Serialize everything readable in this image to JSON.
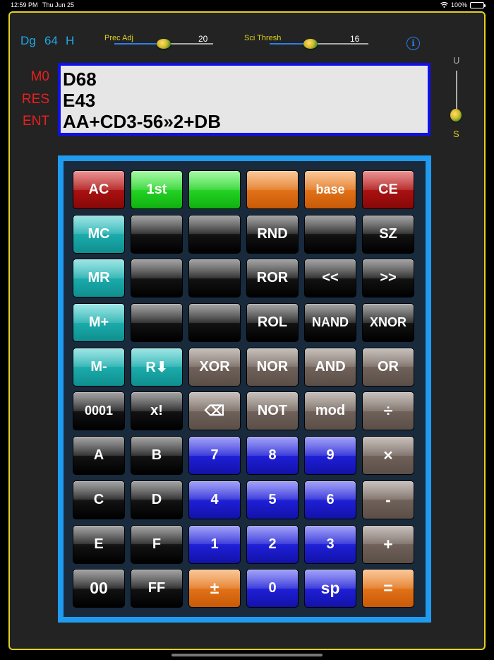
{
  "status_bar": {
    "time": "12:59 PM",
    "date": "Thu Jun 25",
    "battery": "100%"
  },
  "mode": {
    "dg": "Dg",
    "bits": "64",
    "base": "H"
  },
  "prec_adj": {
    "label": "Prec Adj",
    "value": "20"
  },
  "sci_thresh": {
    "label": "Sci Thresh",
    "value": "16"
  },
  "info": {
    "glyph": "i"
  },
  "vertical_slider": {
    "top_label": "U",
    "bottom_label": "S"
  },
  "registers": {
    "labels": [
      "M0",
      "RES",
      "ENT"
    ],
    "values": [
      "D68",
      "E43",
      "AA+CD3-56»2+DB"
    ]
  },
  "keys": [
    {
      "label": "AC",
      "color": "red"
    },
    {
      "label": "1st",
      "color": "green"
    },
    {
      "label": "",
      "color": "green"
    },
    {
      "label": "",
      "color": "orange"
    },
    {
      "label": "base",
      "color": "orange"
    },
    {
      "label": "CE",
      "color": "red"
    },
    {
      "label": "MC",
      "color": "teal"
    },
    {
      "label": "",
      "color": "black"
    },
    {
      "label": "",
      "color": "black"
    },
    {
      "label": "RND",
      "color": "black"
    },
    {
      "label": "",
      "color": "black"
    },
    {
      "label": "SZ",
      "color": "black"
    },
    {
      "label": "MR",
      "color": "teal"
    },
    {
      "label": "",
      "color": "black"
    },
    {
      "label": "",
      "color": "black"
    },
    {
      "label": "ROR",
      "color": "black"
    },
    {
      "label": "<<",
      "color": "black"
    },
    {
      "label": ">>",
      "color": "black"
    },
    {
      "label": "M+",
      "color": "teal"
    },
    {
      "label": "",
      "color": "black"
    },
    {
      "label": "",
      "color": "black"
    },
    {
      "label": "ROL",
      "color": "black"
    },
    {
      "label": "NAND",
      "color": "black"
    },
    {
      "label": "XNOR",
      "color": "black"
    },
    {
      "label": "M-",
      "color": "teal"
    },
    {
      "label": "R⬇",
      "color": "teal"
    },
    {
      "label": "XOR",
      "color": "gray"
    },
    {
      "label": "NOR",
      "color": "gray"
    },
    {
      "label": "AND",
      "color": "gray"
    },
    {
      "label": "OR",
      "color": "gray"
    },
    {
      "label": "0001",
      "color": "black"
    },
    {
      "label": "x!",
      "color": "black"
    },
    {
      "label": "⌫",
      "color": "gray"
    },
    {
      "label": "NOT",
      "color": "gray"
    },
    {
      "label": "mod",
      "color": "gray"
    },
    {
      "label": "÷",
      "color": "gray"
    },
    {
      "label": "A",
      "color": "black"
    },
    {
      "label": "B",
      "color": "black"
    },
    {
      "label": "7",
      "color": "blue"
    },
    {
      "label": "8",
      "color": "blue"
    },
    {
      "label": "9",
      "color": "blue"
    },
    {
      "label": "×",
      "color": "gray"
    },
    {
      "label": "C",
      "color": "black"
    },
    {
      "label": "D",
      "color": "black"
    },
    {
      "label": "4",
      "color": "blue"
    },
    {
      "label": "5",
      "color": "blue"
    },
    {
      "label": "6",
      "color": "blue"
    },
    {
      "label": "-",
      "color": "gray"
    },
    {
      "label": "E",
      "color": "black"
    },
    {
      "label": "F",
      "color": "black"
    },
    {
      "label": "1",
      "color": "blue"
    },
    {
      "label": "2",
      "color": "blue"
    },
    {
      "label": "3",
      "color": "blue"
    },
    {
      "label": "+",
      "color": "gray"
    },
    {
      "label": "00",
      "color": "black"
    },
    {
      "label": "FF",
      "color": "black"
    },
    {
      "label": "±",
      "color": "orange"
    },
    {
      "label": "0",
      "color": "blue"
    },
    {
      "label": "sp",
      "color": "blue"
    },
    {
      "label": "=",
      "color": "orange"
    }
  ]
}
